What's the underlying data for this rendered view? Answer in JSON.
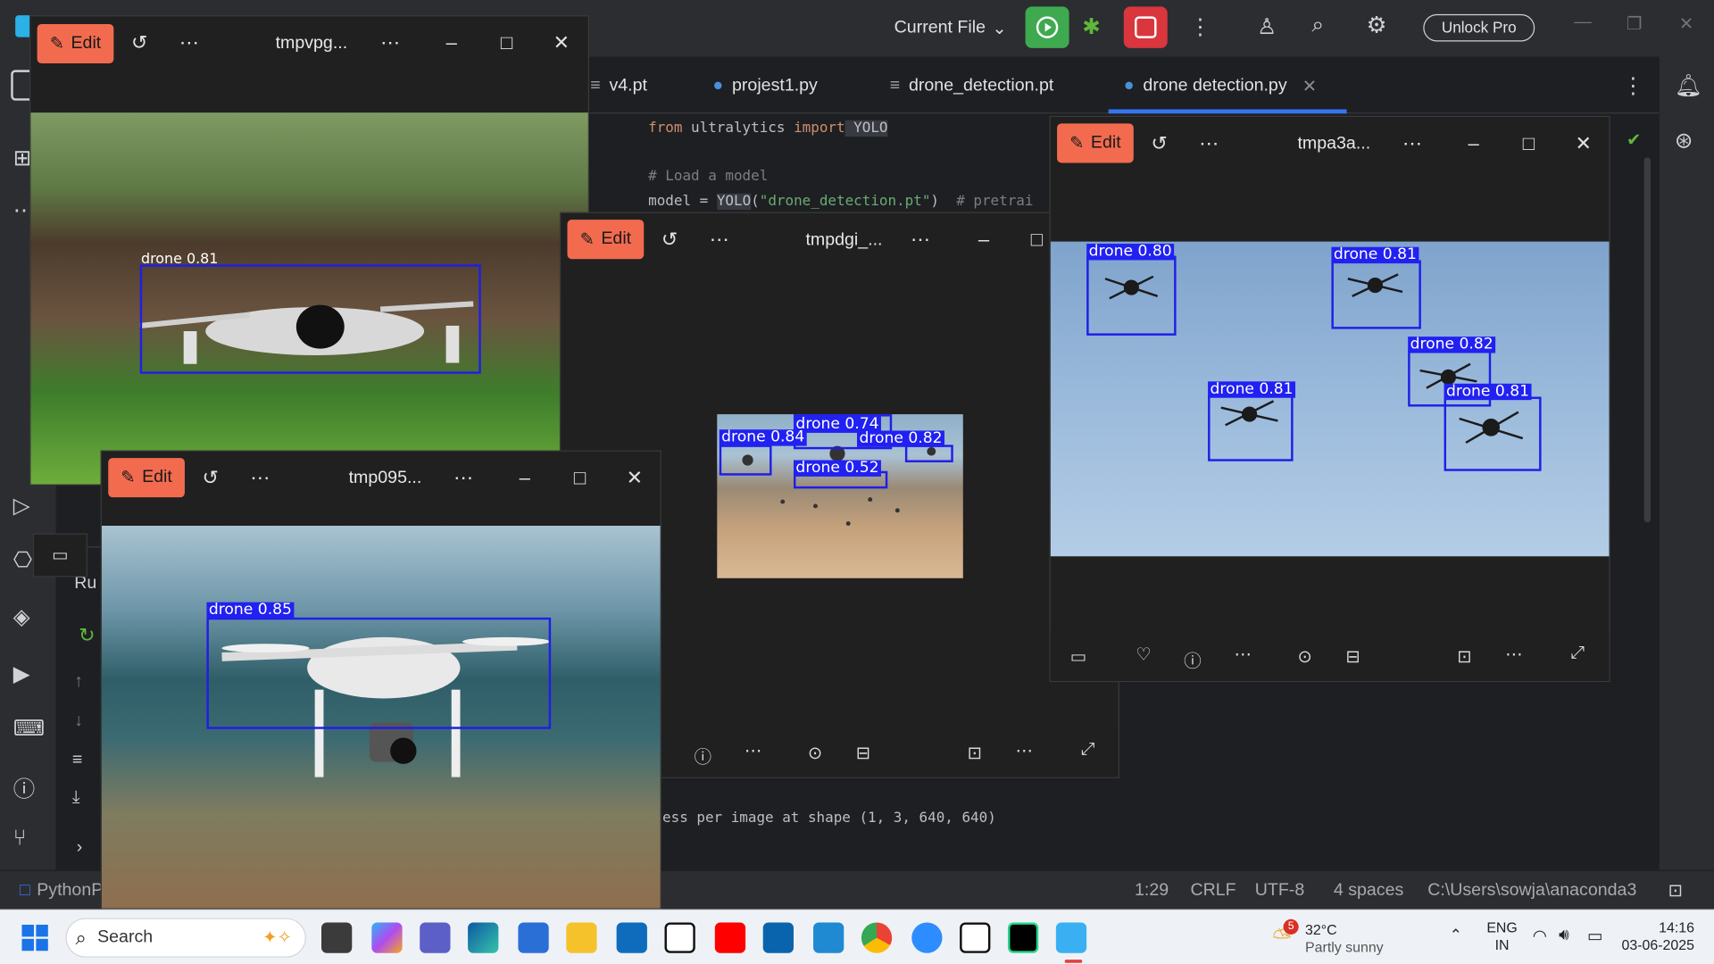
{
  "ide": {
    "run_config": "Current File",
    "unlock_label": "Unlock Pro",
    "tabs": [
      "v4.pt",
      "projest1.py",
      "drone_detection.pt",
      "drone detection.py"
    ],
    "code": {
      "line1_from": "from",
      "line1_mod": " ultralytics ",
      "line1_import": "import",
      "line1_cls": " YOLO",
      "line3": "# Load a model",
      "line4_a": "model = ",
      "line4_b": "YOLO",
      "line4_c": "(",
      "line4_str": "\"drone_detection.pt\"",
      "line4_d": ")  ",
      "line4_cmt": "# pretrai"
    },
    "output_line": "ess per image at shape (1, 3, 640, 640)",
    "run_label": "Ru"
  },
  "status": {
    "project": "PythonP",
    "position": "1:29",
    "line_sep": "CRLF",
    "encoding": "UTF-8",
    "indent": "4 spaces",
    "interpreter": "C:\\Users\\sowja\\anaconda3"
  },
  "windows": {
    "edit_label": "Edit",
    "w1": {
      "title": "tmpvpg...",
      "label": "drone 0.81"
    },
    "w2": {
      "title": "tmpdgi_...",
      "labels": [
        "drone 0.74",
        "drone 0.84",
        "drone 0.82",
        "drone 0.52"
      ]
    },
    "w3": {
      "title": "tmpa3a...",
      "labels": [
        "drone 0.80",
        "drone 0.81",
        "drone 0.82",
        "drone 0.81",
        "drone 0.81"
      ]
    },
    "w4": {
      "title": "tmp095...",
      "label": "drone 0.85"
    }
  },
  "taskbar": {
    "search_placeholder": "Search",
    "weather_temp": "32°C",
    "weather_desc": "Partly sunny",
    "weather_badge": "5",
    "lang1": "ENG",
    "lang2": "IN",
    "time": "14:16",
    "date": "03-06-2025"
  },
  "colors": {
    "accent": "#f26b4f",
    "detection": "#2121f2",
    "run_green": "#3fa950",
    "stop_red": "#d9363e"
  }
}
